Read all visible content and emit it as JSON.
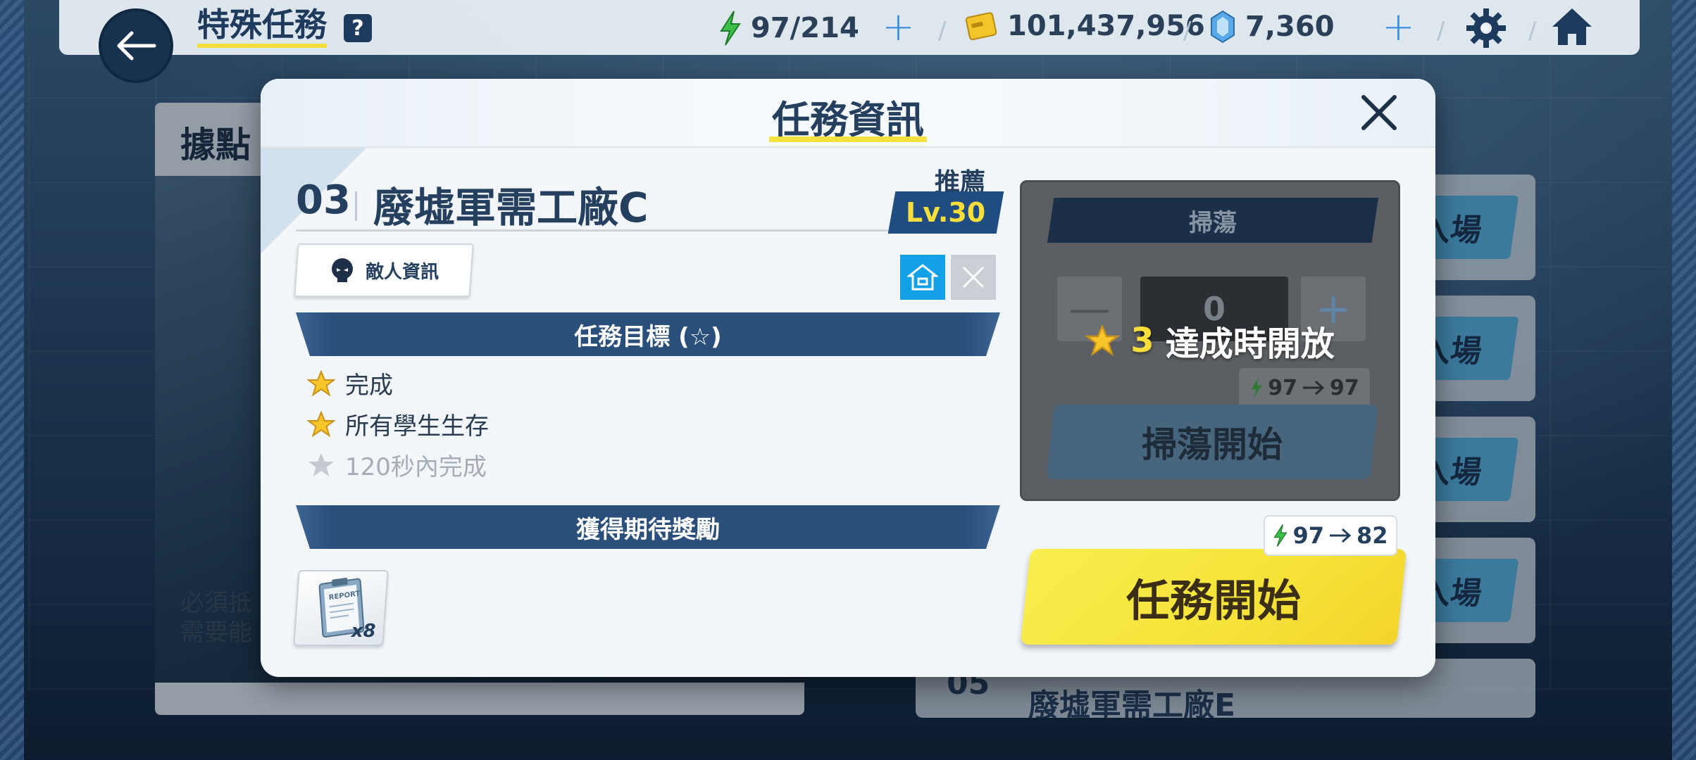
{
  "topbar": {
    "title": "特殊任務",
    "help_icon": "?",
    "ap": "97/214",
    "credits": "101,437,956",
    "gems": "7,360",
    "separator": "/"
  },
  "left_panel": {
    "title": "據點",
    "desc_line1": "必須抵",
    "desc_line2": "需要能"
  },
  "right_list": {
    "enter_label": "入場",
    "row5_num": "05",
    "row5_name": "廢墟軍需工廠E"
  },
  "modal": {
    "title": "任務資訊",
    "stage_number": "03",
    "stage_name": "廢墟軍需工廠C",
    "recommended_label": "推薦",
    "recommended_level": "Lv.30",
    "enemy_info_label": "敵人資訊",
    "objectives_header": "任務目標 (☆)",
    "objectives": [
      {
        "text": "完成",
        "achieved": true
      },
      {
        "text": "所有學生生存",
        "achieved": true
      },
      {
        "text": "120秒內完成",
        "achieved": false
      }
    ],
    "rewards_header": "獲得期待獎勵",
    "reward_count": "x8",
    "reward_item_label": "REPORT"
  },
  "sweep": {
    "title": "掃蕩",
    "minus": "—",
    "plus": "+",
    "count": "0",
    "unlock_stars": "3",
    "unlock_text": "達成時開放",
    "cost_from": "97",
    "cost_to": "97",
    "start_label": "掃蕩開始"
  },
  "mission": {
    "cost_from": "97",
    "cost_to": "82",
    "start_label": "任務開始"
  },
  "colors": {
    "accent_yellow": "#f6e43a",
    "navy": "#25405e",
    "section_blue": "#2b4f7b",
    "star_gold": "#f7c52a"
  }
}
